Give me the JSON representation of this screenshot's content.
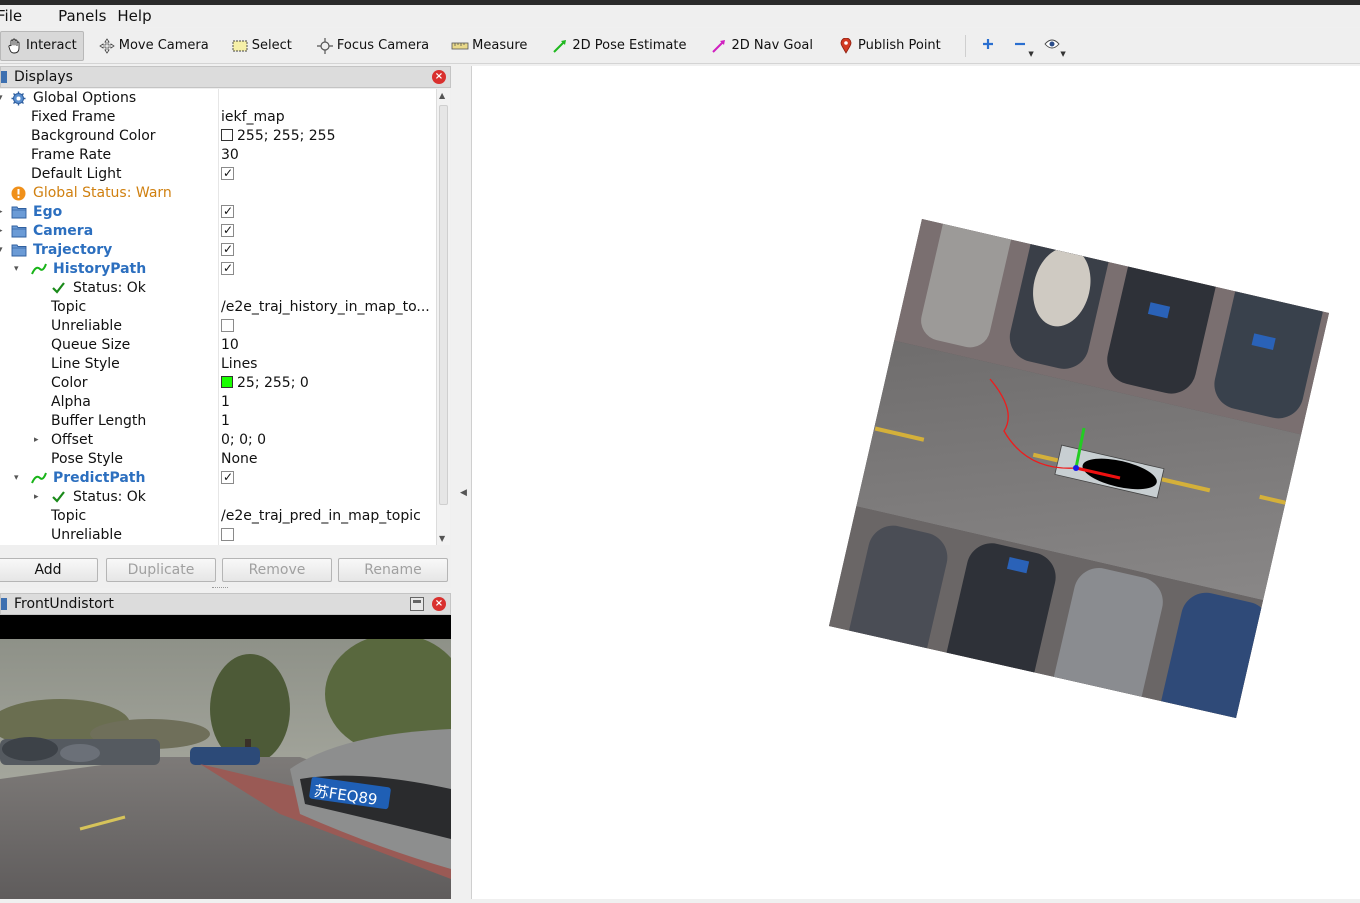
{
  "menu": {
    "items": [
      {
        "label": "File"
      },
      {
        "label": "Panels"
      },
      {
        "label": "Help"
      }
    ]
  },
  "toolbar": {
    "tools": [
      {
        "label": "Interact",
        "icon": "hand-pointer-icon",
        "active": true
      },
      {
        "label": "Move Camera",
        "icon": "move-camera-icon"
      },
      {
        "label": "Select",
        "icon": "select-box-icon"
      },
      {
        "label": "Focus Camera",
        "icon": "focus-camera-icon"
      },
      {
        "label": "Measure",
        "icon": "ruler-icon"
      },
      {
        "label": "2D Pose Estimate",
        "icon": "green-arrow-icon"
      },
      {
        "label": "2D Nav Goal",
        "icon": "pink-arrow-icon"
      },
      {
        "label": "Publish Point",
        "icon": "map-pin-icon"
      }
    ],
    "extra_icons": [
      "add-tool-icon",
      "remove-tool-icon",
      "eye-icon"
    ]
  },
  "displays": {
    "title": "Displays",
    "rows": [
      {
        "name": "Global Options",
        "value": ""
      },
      {
        "name": "Fixed Frame",
        "value": "iekf_map"
      },
      {
        "name": "Background Color",
        "value": "255; 255; 255"
      },
      {
        "name": "Frame Rate",
        "value": "30"
      },
      {
        "name": "Default Light",
        "value": ""
      },
      {
        "name": "Global Status: Warn",
        "value": ""
      },
      {
        "name": "Ego",
        "value": ""
      },
      {
        "name": "Camera",
        "value": ""
      },
      {
        "name": "Trajectory",
        "value": ""
      },
      {
        "name": "HistoryPath",
        "value": ""
      },
      {
        "name": "Status: Ok",
        "value": ""
      },
      {
        "name": "Topic",
        "value": "/e2e_traj_history_in_map_to..."
      },
      {
        "name": "Unreliable",
        "value": ""
      },
      {
        "name": "Queue Size",
        "value": "10"
      },
      {
        "name": "Line Style",
        "value": "Lines"
      },
      {
        "name": "Color",
        "value": "25; 255; 0"
      },
      {
        "name": "Alpha",
        "value": "1"
      },
      {
        "name": "Buffer Length",
        "value": "1"
      },
      {
        "name": "Offset",
        "value": "0; 0; 0"
      },
      {
        "name": "Pose Style",
        "value": "None"
      },
      {
        "name": "PredictPath",
        "value": ""
      },
      {
        "name": "Status: Ok",
        "value": ""
      },
      {
        "name": "Topic",
        "value": "/e2e_traj_pred_in_map_topic"
      },
      {
        "name": "Unreliable",
        "value": ""
      }
    ],
    "checks": {
      "default_light": true,
      "ego": true,
      "camera": true,
      "trajectory": true,
      "history_path": true,
      "history_unreliable": false,
      "predict_path": true,
      "predict_unreliable": false
    },
    "colors": {
      "background": "#ffffff",
      "history_path": "#19ff00"
    },
    "buttons": {
      "add": "Add",
      "duplicate": "Duplicate",
      "remove": "Remove",
      "rename": "Rename"
    }
  },
  "camera_panel": {
    "title": "FrontUndistort",
    "plate_text": "苏FEQ89"
  },
  "viewport": {
    "background": "#ffffff"
  }
}
